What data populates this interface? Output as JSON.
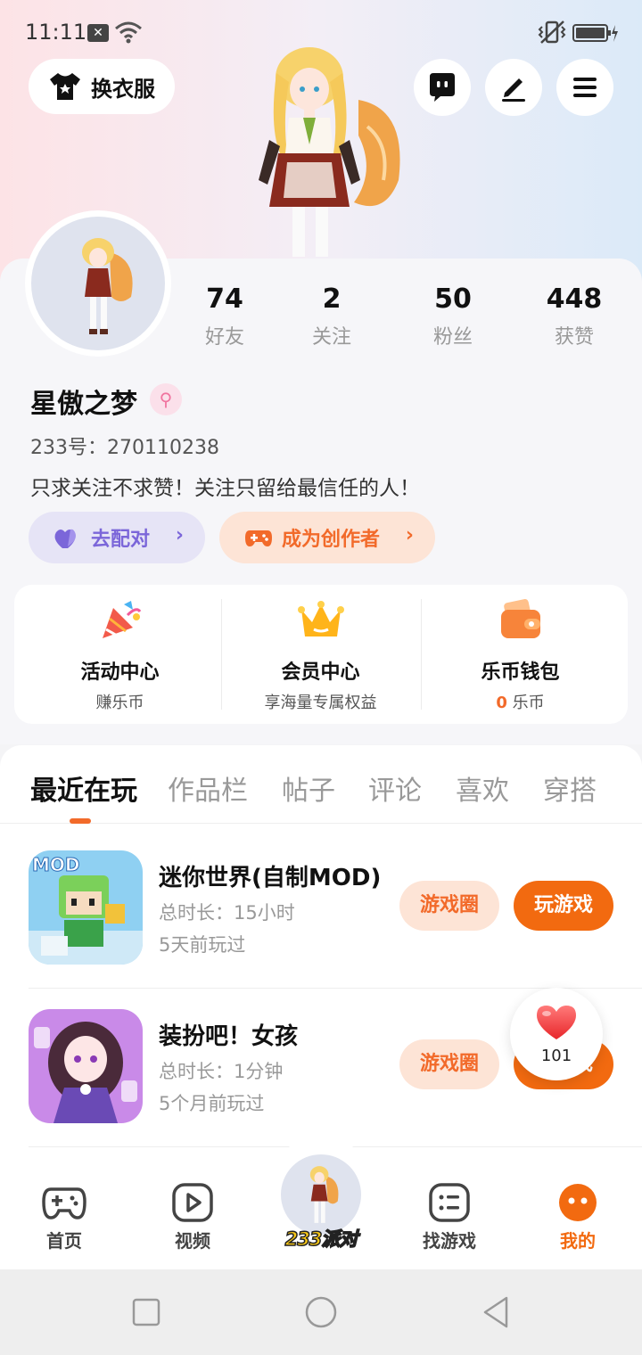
{
  "status_bar": {
    "time": "11:11",
    "notification_glyph": "✕"
  },
  "header": {
    "outfit_label": "换衣服",
    "icons": [
      "tshirt-icon",
      "chat-bubble-icon",
      "edit-pen-icon",
      "menu-icon"
    ]
  },
  "profile": {
    "stats": [
      {
        "value": "74",
        "label": "好友"
      },
      {
        "value": "2",
        "label": "关注"
      },
      {
        "value": "50",
        "label": "粉丝"
      },
      {
        "value": "448",
        "label": "获赞"
      }
    ],
    "username": "星傲之梦",
    "gender_symbol": "⚲",
    "user_id": "233号：270110238",
    "bio": "只求关注不求赞！关注只留给最信任的人！",
    "match_label": "去配对",
    "creator_label": "成为创作者",
    "chevron": "›"
  },
  "quick_entries": [
    {
      "title": "活动中心",
      "subtitle": "赚乐币",
      "icon": "party-popper-icon"
    },
    {
      "title": "会员中心",
      "subtitle": "享海量专属权益",
      "icon": "crown-icon"
    },
    {
      "title": "乐币钱包",
      "subtitle_value": "0",
      "subtitle_unit": "乐币",
      "icon": "wallet-icon"
    }
  ],
  "tabs": [
    "最近在玩",
    "作品栏",
    "帖子",
    "评论",
    "喜欢",
    "穿搭"
  ],
  "games": [
    {
      "name": "迷你世界(自制MOD)",
      "time": "总时长：15小时",
      "last_played": "5天前玩过",
      "icon_text": "MOD",
      "circle_label": "游戏圈",
      "play_label": "玩游戏"
    },
    {
      "name": "装扮吧！女孩",
      "time": "总时长：1分钟",
      "last_played": "5个月前玩过",
      "circle_label": "游戏圈",
      "play_label": "玩游戏"
    }
  ],
  "like_bubble": {
    "count": "101"
  },
  "bottom_nav": {
    "items": [
      {
        "label": "首页",
        "icon": "gamepad-icon"
      },
      {
        "label": "视频",
        "icon": "video-play-icon"
      },
      {
        "label": "233派对",
        "icon": "party-avatar"
      },
      {
        "label": "找游戏",
        "icon": "game-list-icon"
      },
      {
        "label": "我的",
        "icon": "profile-face-icon"
      }
    ],
    "active": "我的"
  },
  "colors": {
    "accent": "#f26a10",
    "purple": "#7b66d9",
    "pink": "#f0749f"
  }
}
